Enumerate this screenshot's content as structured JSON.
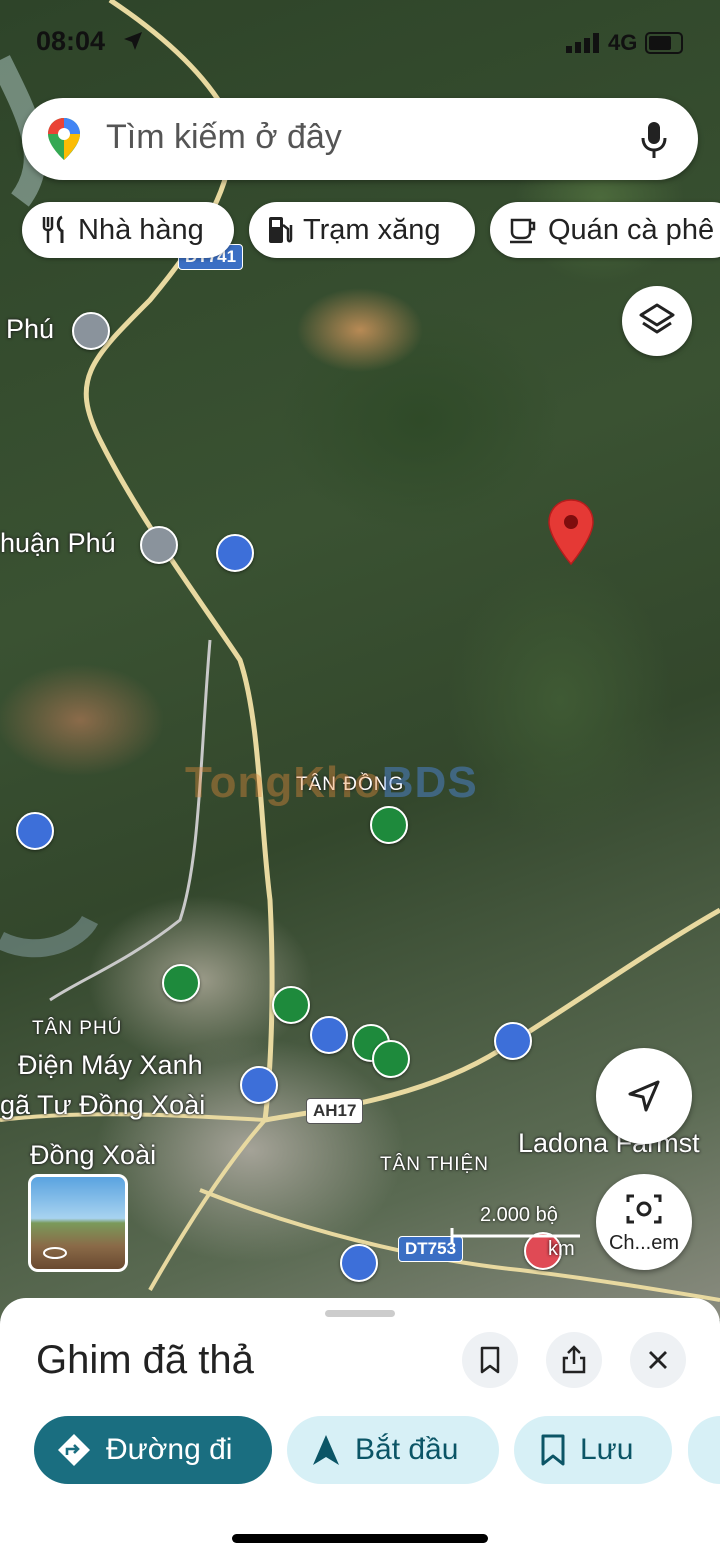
{
  "status": {
    "time": "08:04",
    "network": "4G"
  },
  "search": {
    "placeholder": "Tìm kiếm ở đây"
  },
  "chips": [
    {
      "label": "Nhà hàng",
      "icon": "restaurant-icon"
    },
    {
      "label": "Trạm xăng",
      "icon": "gas-station-icon"
    },
    {
      "label": "Quán cà phê",
      "icon": "coffee-icon"
    }
  ],
  "map": {
    "place_labels": [
      "Phú",
      "huận Phú",
      "TÂN ĐỒNG",
      "TÂN PHÚ",
      "Điện Máy Xanh",
      "gã Tư Đồng Xoài",
      "Đồng Xoài",
      "TÂN THIỆN",
      "Ladona Farmst"
    ],
    "road_shields": [
      "DT741",
      "AH17",
      "DT753"
    ],
    "watermark": {
      "part1": "TongKho",
      "part2": "BDS"
    },
    "scale": {
      "label": "2.000 bộ",
      "km": "km"
    },
    "marker_color": "#e53935"
  },
  "fab": {
    "camera_label": "Ch...em"
  },
  "sheet": {
    "title": "Ghim đã thả",
    "actions": [
      {
        "label": "Đường đi",
        "style": "primary"
      },
      {
        "label": "Bắt đầu",
        "style": "secondary"
      },
      {
        "label": "Lưu",
        "style": "secondary"
      }
    ]
  },
  "colors": {
    "accent": "#1a6e80",
    "secondary_bg": "#d7f0f6",
    "primary_fg": "#ffffff",
    "secondary_fg": "#0b5566"
  }
}
